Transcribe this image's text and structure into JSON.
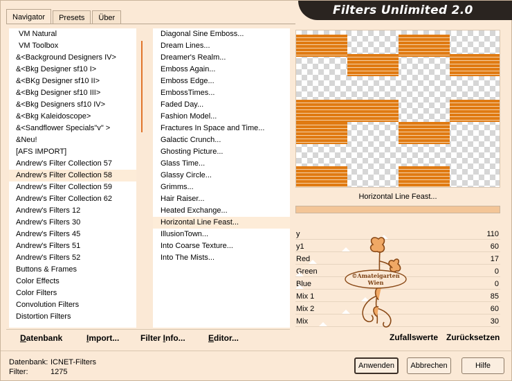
{
  "window": {
    "title": "Filters Unlimited 2.0"
  },
  "tabs": [
    {
      "label": "Navigator",
      "active": true
    },
    {
      "label": "Presets",
      "active": false
    },
    {
      "label": "Über",
      "active": false
    }
  ],
  "categories": {
    "items": [
      "VM Natural",
      "VM Toolbox",
      "&<Background Designers IV>",
      "&<Bkg Designer sf10 I>",
      "&<BKg Designer sf10 II>",
      "&<Bkg Designer sf10 III>",
      "&<Bkg Designers sf10 IV>",
      "&<Bkg Kaleidoscope>",
      "&<Sandflower Specials\"v\" >",
      "&Neu!",
      "[AFS IMPORT]",
      "Andrew's Filter Collection 57",
      "Andrew's Filter Collection 58",
      "Andrew's Filter Collection 59",
      "Andrew's Filter Collection 62",
      "Andrew's Filters 12",
      "Andrew's Filters 30",
      "Andrew's Filters 45",
      "Andrew's Filters 51",
      "Andrew's Filters 52",
      "Buttons & Frames",
      "Color Effects",
      "Color Filters",
      "Convolution Filters",
      "Distortion Filters"
    ],
    "selected_index": 12
  },
  "filters": {
    "items": [
      "Diagonal Sine Emboss...",
      "Dream Lines...",
      "Dreamer's Realm...",
      "Emboss Again...",
      "Emboss Edge...",
      "EmbossTimes...",
      "Faded Day...",
      "Fashion Model...",
      "Fractures In Space and Time...",
      "Galactic Crunch...",
      "Ghosting Picture...",
      "Glass Time...",
      "Glassy Circle...",
      "Grimms...",
      "Hair Raiser...",
      "Heated Exchange...",
      "Horizontal Line Feast...",
      "IllusionTown...",
      "Into Coarse Texture...",
      "Into The Mists..."
    ],
    "selected_index": 16
  },
  "preview": {
    "label": "Horizontal Line Feast...",
    "progress": 1.0,
    "stripe_color": "#e07a12"
  },
  "params": [
    {
      "name": "y",
      "value": "110",
      "level": 0.431
    },
    {
      "name": "y1",
      "value": "60",
      "level": 0.235
    },
    {
      "name": "Red",
      "value": "17",
      "level": 0.067
    },
    {
      "name": "Green",
      "value": "0",
      "level": 0.0
    },
    {
      "name": "Blue",
      "value": "0",
      "level": 0.0
    },
    {
      "name": "Mix 1",
      "value": "85",
      "level": 0.333
    },
    {
      "name": "Mix 2",
      "value": "60",
      "level": 0.235
    },
    {
      "name": "Mix",
      "value": "30",
      "level": 0.118
    }
  ],
  "watermark": {
    "line1": "©Amateigarten",
    "line2": "Wien"
  },
  "actions": {
    "database": {
      "underline": "D",
      "rest": "atenbank"
    },
    "import": {
      "pre": "I",
      "rest": "mport..."
    },
    "filter_info": {
      "pre": "Filter ",
      "underline": "I",
      "rest": "nfo..."
    },
    "editor": {
      "underline": "E",
      "rest": "ditor..."
    },
    "random": "Zufallswerte",
    "reset": "Zurücksetzen"
  },
  "status": {
    "database_label": "Datenbank:",
    "database_value": "ICNET-Filters",
    "filter_label": "Filter:",
    "filter_value": "1275"
  },
  "buttons": {
    "apply": "Anwenden",
    "cancel": "Abbrechen",
    "help": "Hilfe"
  }
}
